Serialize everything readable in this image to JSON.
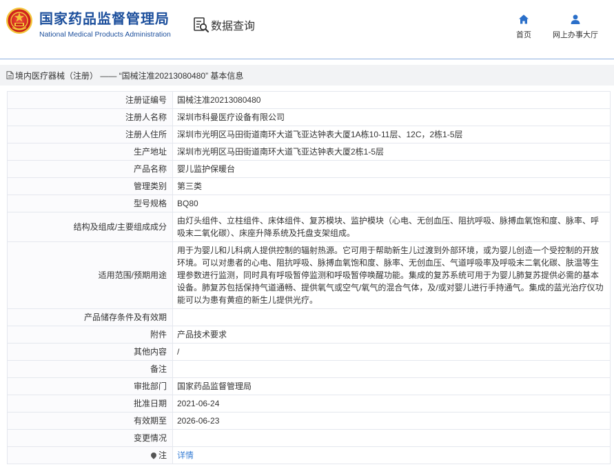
{
  "header": {
    "agency_cn": "国家药品监督管理局",
    "agency_en": "National Medical Products Administration",
    "data_query": "数据查询",
    "nav": [
      {
        "label": "首页",
        "icon": "home-icon"
      },
      {
        "label": "网上办事大厅",
        "icon": "user-icon"
      }
    ]
  },
  "breadcrumb": {
    "text": "境内医疗器械（注册） —— “国械注准20213080480” 基本信息",
    "icon": "document-icon"
  },
  "rows": [
    {
      "label": "注册证编号",
      "value": "国械注准20213080480"
    },
    {
      "label": "注册人名称",
      "value": "深圳市科曼医疗设备有限公司"
    },
    {
      "label": "注册人住所",
      "value": "深圳市光明区马田街道南环大道飞亚达钟表大厦1A栋10-11层、12C，2栋1-5层"
    },
    {
      "label": "生产地址",
      "value": "深圳市光明区马田街道南环大道飞亚达钟表大厦2栋1-5层"
    },
    {
      "label": "产品名称",
      "value": "婴儿监护保暖台"
    },
    {
      "label": "管理类别",
      "value": "第三类"
    },
    {
      "label": "型号规格",
      "value": "BQ80"
    },
    {
      "label": "结构及组成/主要组成成分",
      "value": "由灯头组件、立柱组件、床体组件、复苏模块、监护模块（心电、无创血压、阻抗呼吸、脉搏血氧饱和度、脉率、呼吸末二氧化碳）、床座升降系统及托盘支架组成。"
    },
    {
      "label": "适用范围/预期用途",
      "value": "用于为婴儿和儿科病人提供控制的辐射热源。它可用于帮助新生儿过渡到外部环境，或为婴儿创造一个受控制的开放环境。可以对患者的心电、阻抗呼吸、脉搏血氧饱和度、脉率、无创血压、气道呼吸率及呼吸末二氧化碳、肤温等生理参数进行监测，同时具有呼吸暂停监测和呼吸暂停唤醒功能。集成的复苏系统可用于为婴儿肺复苏提供必需的基本设备。肺复苏包括保持气道通畅、提供氧气或空气/氧气的混合气体，及/或对婴儿进行手持通气。集成的蓝光治疗仪功能可以为患有黄疸的新生儿提供光疗。"
    },
    {
      "label": "产品储存条件及有效期",
      "value": ""
    },
    {
      "label": "附件",
      "value": "产品技术要求"
    },
    {
      "label": "其他内容",
      "value": "/"
    },
    {
      "label": "备注",
      "value": ""
    },
    {
      "label": "审批部门",
      "value": "国家药品监督管理局"
    },
    {
      "label": "批准日期",
      "value": "2021-06-24"
    },
    {
      "label": "有效期至",
      "value": "2026-06-23"
    },
    {
      "label": "变更情况",
      "value": ""
    },
    {
      "label": "注",
      "value": "详情"
    }
  ],
  "colors": {
    "title_blue": "#1c4f9c",
    "nav_icon_blue": "#2a6fc9",
    "link_blue": "#3a7fd5",
    "label_bg": "#fbfbfd",
    "border": "#e4e7ee",
    "breadcrumb_bg": "#f2f3f5",
    "emblem_red": "#d9241b",
    "emblem_gold": "#f3c53a"
  }
}
